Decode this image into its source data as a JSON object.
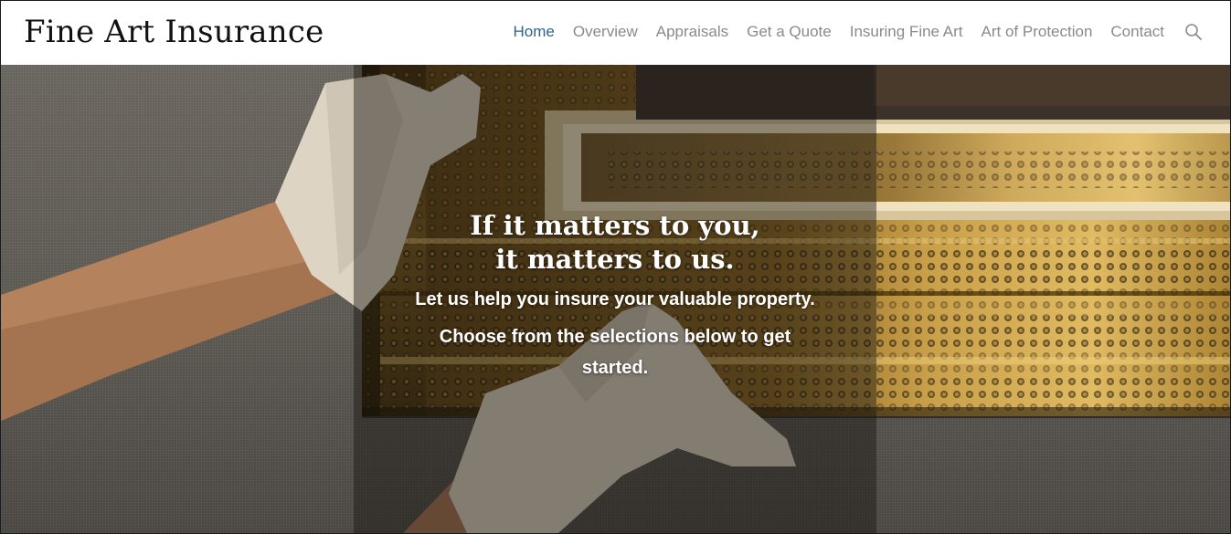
{
  "site": {
    "title": "Fine Art Insurance"
  },
  "nav": {
    "items": [
      {
        "label": "Home",
        "active": true
      },
      {
        "label": "Overview",
        "active": false
      },
      {
        "label": "Appraisals",
        "active": false
      },
      {
        "label": "Get a Quote",
        "active": false
      },
      {
        "label": "Insuring Fine Art",
        "active": false
      },
      {
        "label": "Art of Protection",
        "active": false
      },
      {
        "label": "Contact",
        "active": false
      }
    ],
    "search_icon": "search-icon"
  },
  "hero": {
    "headline_line1": "If it matters to you,",
    "headline_line2": "it matters to us.",
    "subtitle": "Let us help you insure your valuable property.",
    "cta_text": "Choose from the selections below to get started."
  },
  "colors": {
    "nav_active": "#2a6496",
    "nav_default": "#8a8a8a",
    "logo": "#111111",
    "hero_overlay": "rgba(25,22,18,0.45)"
  }
}
